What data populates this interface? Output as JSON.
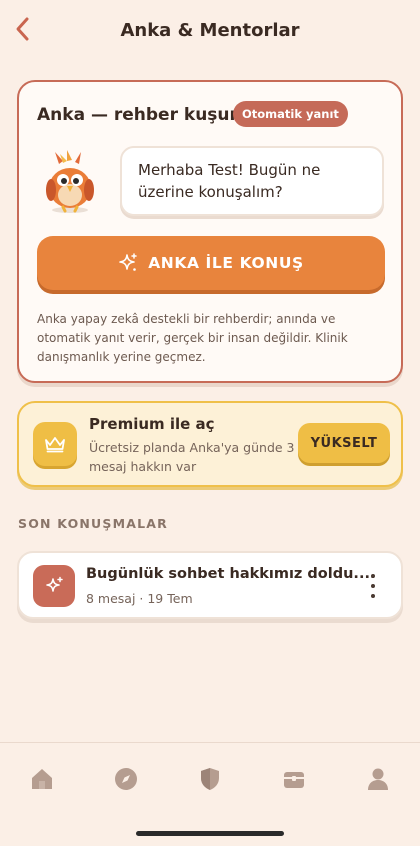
{
  "header": {
    "title": "Anka & Mentorlar",
    "back_icon": "chevron-left-icon"
  },
  "anka_card": {
    "title": "Anka — rehber kuşun",
    "badge": "Otomatik yanıt",
    "greeting": "Merhaba Test! Bugün ne üzerine konuşalım?",
    "cta_label": "ANKA İLE KONUŞ",
    "cta_icon": "sparkle-icon",
    "disclaimer": "Anka yapay zekâ destekli bir rehberdir; anında ve otomatik yanıt verir, gerçek bir insan değildir. Klinik danışmanlık yerine geçmez."
  },
  "premium": {
    "title": "Premium ile aç",
    "subtitle": "Ücretsiz planda Anka'ya günde 3 mesaj hakkın var",
    "button_label": "YÜKSELT",
    "icon": "crown-icon"
  },
  "recent": {
    "section_label": "SON KONUŞMALAR",
    "items": [
      {
        "title": "Bugünlük sohbet hakkımız doldu....",
        "meta": "8 mesaj · 19 Tem",
        "icon": "sparkle-icon"
      }
    ]
  },
  "tabbar": {
    "items": [
      {
        "icon": "home-icon"
      },
      {
        "icon": "compass-icon"
      },
      {
        "icon": "shield-icon"
      },
      {
        "icon": "chest-icon"
      },
      {
        "icon": "profile-icon"
      }
    ]
  },
  "colors": {
    "background": "#fbefe6",
    "accent_orange": "#e8843d",
    "accent_terracotta": "#c56a58",
    "premium_gold": "#efbe45",
    "text_dark": "#3a2a22"
  }
}
